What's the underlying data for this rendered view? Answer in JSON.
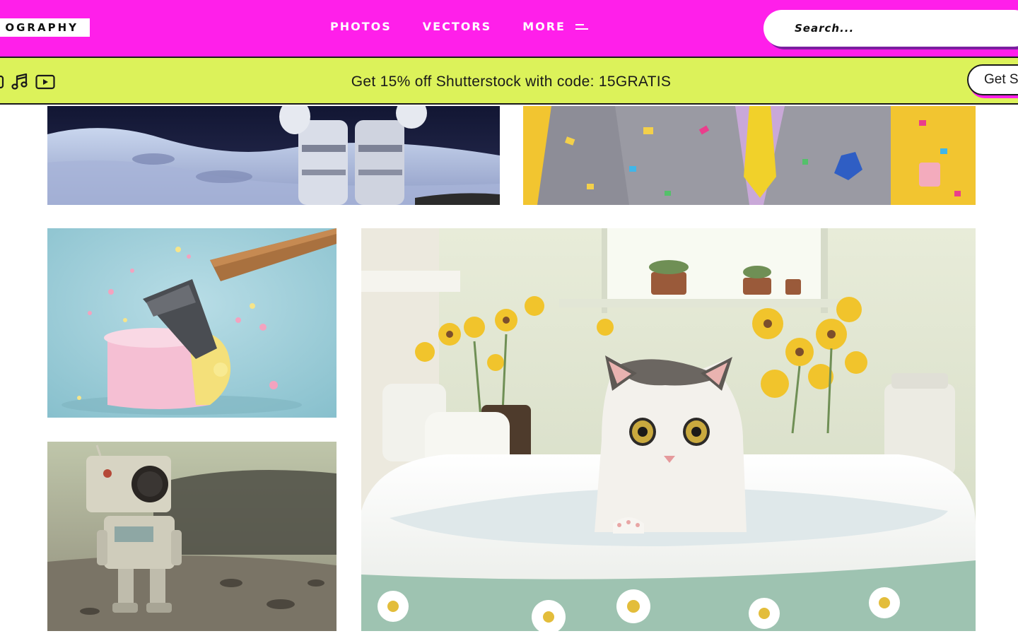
{
  "header": {
    "logo_text": "OGRAPHY",
    "nav": {
      "photos": "PHOTOS",
      "vectors": "VECTORS",
      "more": "MORE"
    },
    "search_placeholder": "Search..."
  },
  "promo": {
    "icons": [
      "image-icon",
      "music-icon",
      "video-play-icon"
    ],
    "text": "Get 15% off Shutterstock with code: 15GRATIS",
    "button_label": "Get S"
  },
  "colors": {
    "header_bg": "#ff1fea",
    "promo_bg": "#dcf25a",
    "button_shadow": "#ff1fea"
  },
  "gallery": {
    "tiles": [
      "astronaut-moon-photo",
      "businessman-confetti-photo",
      "axe-cake-photo",
      "cat-bathtub-photo",
      "retro-robot-photo"
    ]
  }
}
